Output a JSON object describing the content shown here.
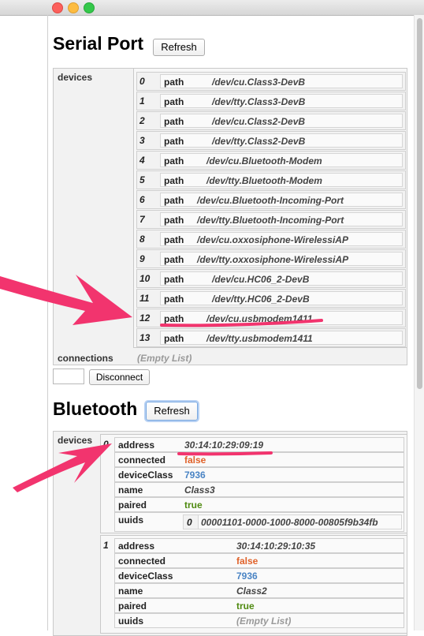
{
  "serial": {
    "title": "Serial Port",
    "refresh_label": "Refresh",
    "devices_label": "devices",
    "key_label": "path",
    "devices": [
      {
        "index": "0",
        "path": "/dev/cu.Class3-DevB"
      },
      {
        "index": "1",
        "path": "/dev/tty.Class3-DevB"
      },
      {
        "index": "2",
        "path": "/dev/cu.Class2-DevB"
      },
      {
        "index": "3",
        "path": "/dev/tty.Class2-DevB"
      },
      {
        "index": "4",
        "path": "/dev/cu.Bluetooth-Modem"
      },
      {
        "index": "5",
        "path": "/dev/tty.Bluetooth-Modem"
      },
      {
        "index": "6",
        "path": "/dev/cu.Bluetooth-Incoming-Port"
      },
      {
        "index": "7",
        "path": "/dev/tty.Bluetooth-Incoming-Port"
      },
      {
        "index": "8",
        "path": "/dev/cu.oxxosiphone-WirelessiAP"
      },
      {
        "index": "9",
        "path": "/dev/tty.oxxosiphone-WirelessiAP"
      },
      {
        "index": "10",
        "path": "/dev/cu.HC06_2-DevB"
      },
      {
        "index": "11",
        "path": "/dev/tty.HC06_2-DevB"
      },
      {
        "index": "12",
        "path": "/dev/cu.usbmodem1411"
      },
      {
        "index": "13",
        "path": "/dev/tty.usbmodem1411"
      }
    ],
    "connections_label": "connections",
    "connections_value": "(Empty List)",
    "connection_input_value": "",
    "disconnect_label": "Disconnect"
  },
  "bluetooth": {
    "title": "Bluetooth",
    "refresh_label": "Refresh",
    "devices_label": "devices",
    "keys": {
      "address": "address",
      "connected": "connected",
      "deviceClass": "deviceClass",
      "name": "name",
      "paired": "paired",
      "uuids": "uuids"
    },
    "devices": [
      {
        "index": "0",
        "address": "30:14:10:29:09:19",
        "connected": "false",
        "deviceClass": "7936",
        "name": "Class3",
        "paired": "true",
        "uuids": [
          {
            "index": "0",
            "value": "00001101-0000-1000-8000-00805f9b34fb"
          }
        ]
      },
      {
        "index": "1",
        "address": "30:14:10:29:10:35",
        "connected": "false",
        "deviceClass": "7936",
        "name": "Class2",
        "paired": "true",
        "uuids_empty": "(Empty List)"
      }
    ]
  },
  "colors": {
    "annotation": "#f2346e",
    "false_value": "#e0622a",
    "true_value": "#4f8a10",
    "number_value": "#4a84c4"
  }
}
